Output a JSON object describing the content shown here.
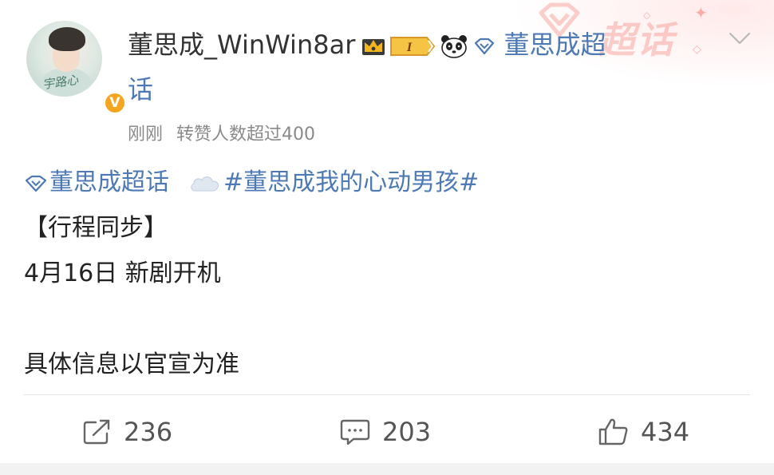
{
  "header": {
    "username": "董思成_WinWin8ar",
    "level_text": "I",
    "topic_name_part1": "董思成超",
    "topic_name_part2": "话",
    "watermark_text": "超话",
    "meta_time": "刚刚",
    "meta_note": "转赞人数超过400"
  },
  "post": {
    "topic_tag": "董思成超话",
    "hashtag": "#董思成我的心动男孩#",
    "line_schedule": "【行程同步】",
    "line_date": "4月16日 新剧开机",
    "line_note": "具体信息以官宣为准"
  },
  "actions": {
    "repost_count": "236",
    "comment_count": "203",
    "like_count": "434"
  },
  "icons": {
    "crown": "crown-icon",
    "level": "level-badge",
    "panda": "panda-icon",
    "topic": "diamond-gem-icon",
    "cloud": "cloud-icon",
    "repost": "share-icon",
    "comment": "comment-icon",
    "like": "thumbs-up-icon",
    "collapse": "chevron-down-icon",
    "verified": "verified-badge-icon"
  },
  "colors": {
    "link": "#4d79b4",
    "meta": "#8a8a8a",
    "text": "#222222",
    "verified": "#f6a521",
    "crown": "#f3b71d"
  },
  "avatar": {
    "signature_text": "宇路心"
  }
}
